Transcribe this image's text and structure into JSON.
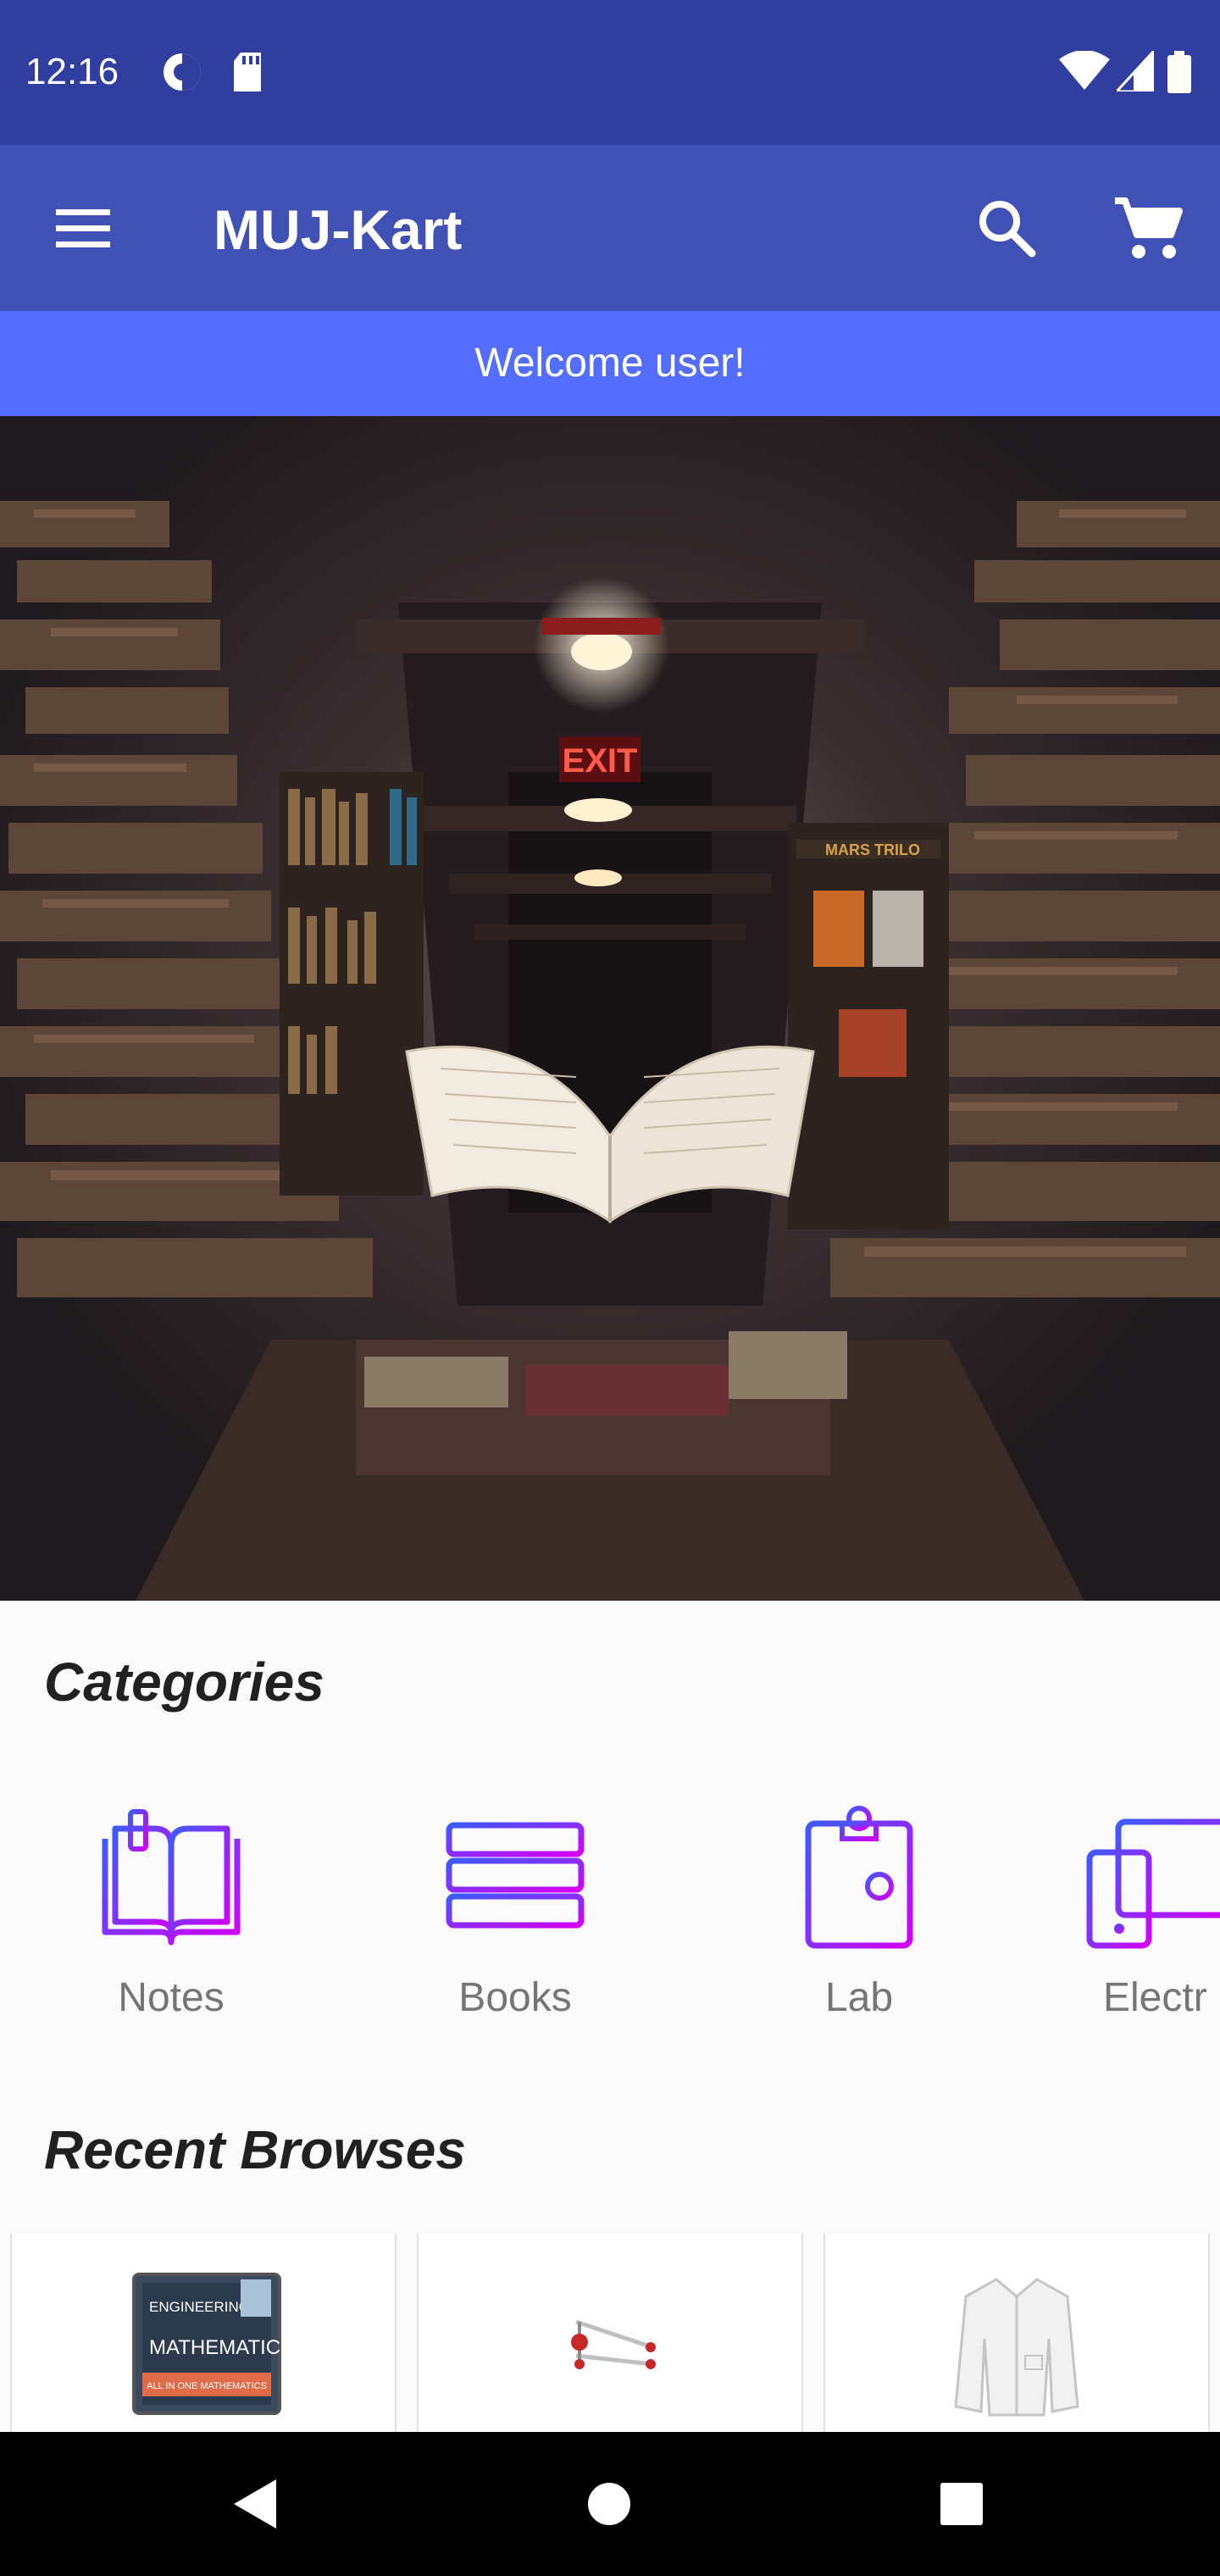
{
  "status_bar": {
    "time": "12:16",
    "icons": [
      "data-saver-icon",
      "sd-card-icon",
      "wifi-icon",
      "signal-icon",
      "battery-icon"
    ]
  },
  "app_bar": {
    "title": "MUJ-Kart",
    "icons": [
      "menu-icon",
      "search-icon",
      "cart-icon"
    ]
  },
  "welcome": {
    "text": "Welcome user!"
  },
  "carousel": {
    "slide_count": 4,
    "active_index": 2,
    "exit_sign": "EXIT",
    "book_spine": "MARS TRILO"
  },
  "categories": {
    "title": "Categories",
    "items": [
      {
        "label": "Notes",
        "icon": "open-book-icon"
      },
      {
        "label": "Books",
        "icon": "book-stack-icon"
      },
      {
        "label": "Lab",
        "icon": "clipboard-id-icon"
      },
      {
        "label": "Electr",
        "icon": "devices-icon"
      }
    ]
  },
  "recent": {
    "title": "Recent Browses",
    "items": [
      {
        "name": "engineering-mathematics-book",
        "cover_line1": "ENGINEERING",
        "cover_line2": "MATHEMATICS",
        "cover_line3": "ALL IN ONE MATHEMATICS"
      },
      {
        "name": "drafter-instrument"
      },
      {
        "name": "lab-coat"
      }
    ]
  },
  "nav_bar": {
    "buttons": [
      "back-icon",
      "home-icon",
      "recents-icon"
    ]
  },
  "colors": {
    "status_bar": "#303f9f",
    "app_bar": "#3f51b5",
    "welcome_bar": "#536dfe",
    "icon_gradient_start": "#3d5afe",
    "icon_gradient_end": "#d500f9"
  }
}
